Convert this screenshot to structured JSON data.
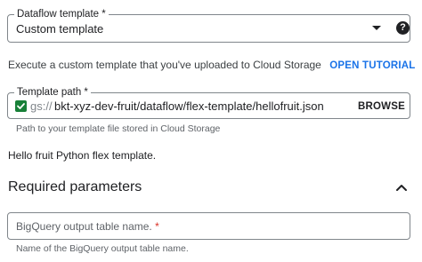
{
  "template_field": {
    "label": "Dataflow template *",
    "value": "Custom template",
    "help_icon_glyph": "?"
  },
  "description": {
    "text": "Execute a custom template that you've uploaded to Cloud Storage",
    "link_label": "OPEN TUTORIAL"
  },
  "template_path": {
    "label": "Template path *",
    "prefix": "gs://",
    "value": "bkt-xyz-dev-fruit/dataflow/flex-template/hellofruit.json",
    "browse_label": "BROWSE",
    "hint": "Path to your template file stored in Cloud Storage",
    "status_icon": "check-icon",
    "status_color": "#188038"
  },
  "template_description": "Hello fruit Python flex template.",
  "required_parameters": {
    "title": "Required parameters",
    "toggle_icon": "chevron-up-icon",
    "bq_output": {
      "placeholder": "BigQuery output table name.",
      "required_mark": "*",
      "hint": "Name of the BigQuery output table name."
    }
  },
  "colors": {
    "link": "#1a73e8",
    "required": "#d93025",
    "hint": "#5f6368",
    "border": "#80868b"
  }
}
